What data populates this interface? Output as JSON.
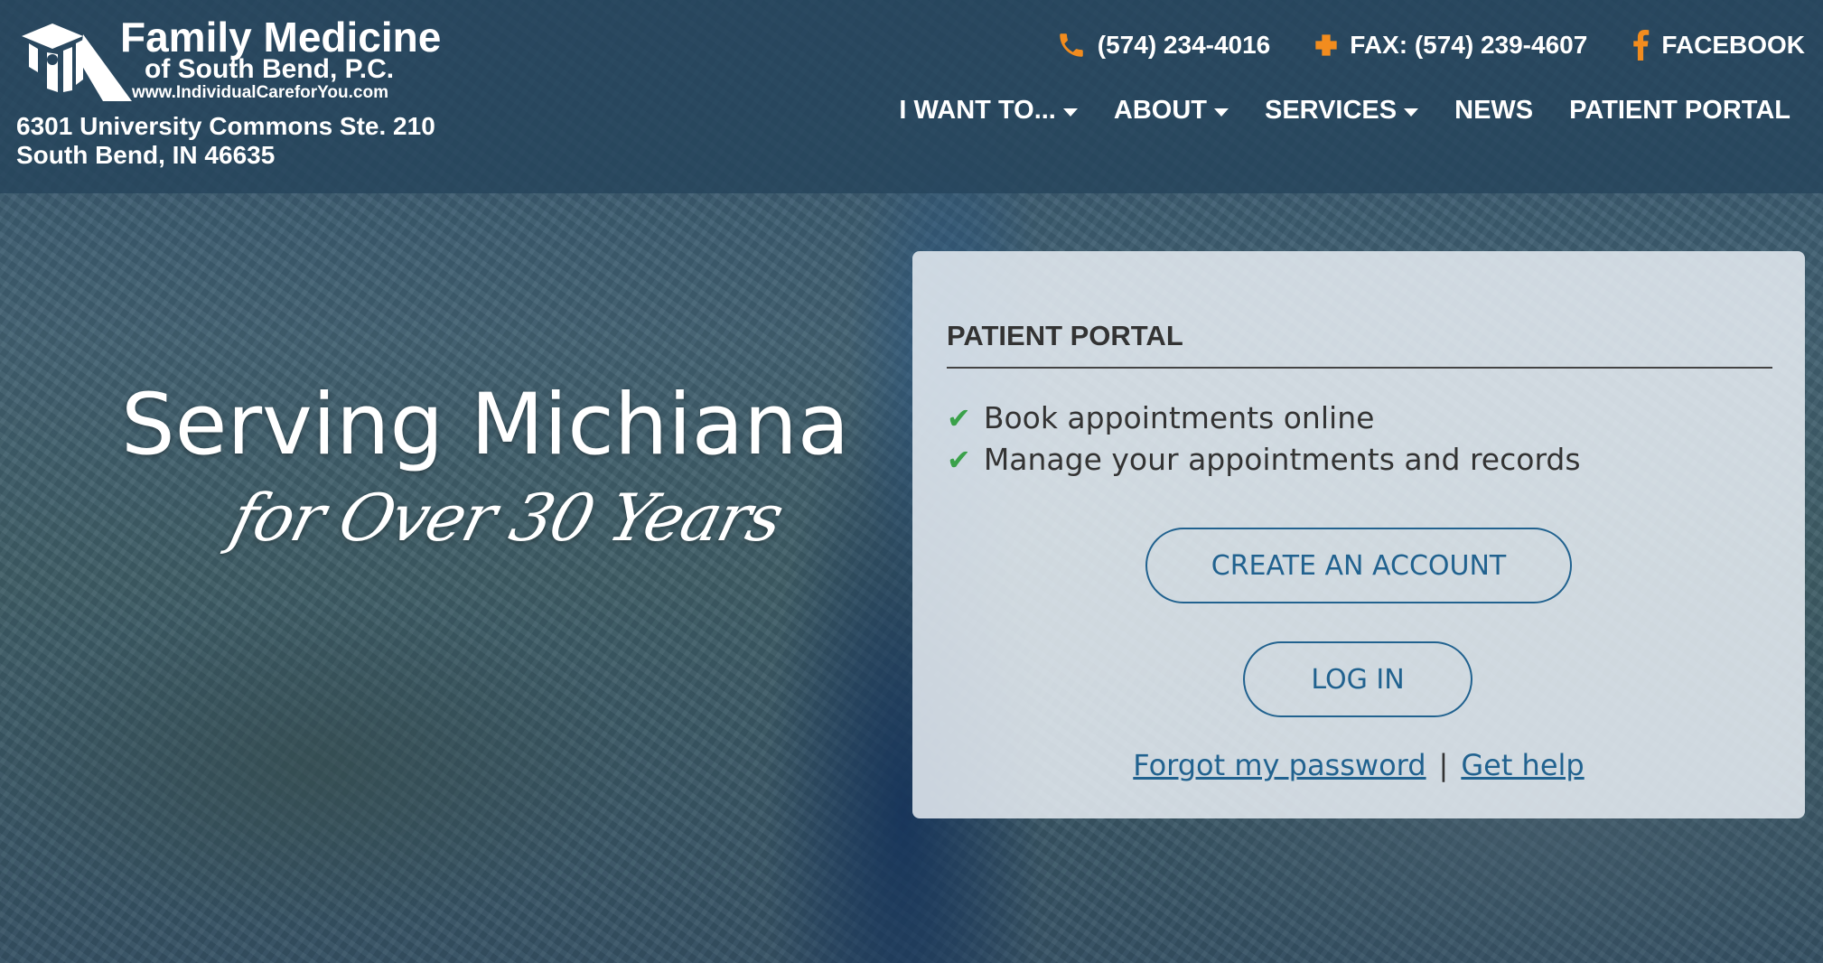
{
  "logo": {
    "title": "Family Medicine",
    "subtitle": "of South Bend, P.C.",
    "url": "www.IndividualCareforYou.com"
  },
  "address": {
    "line1": "6301 University Commons Ste. 210",
    "line2": "South Bend, IN 46635"
  },
  "contact": {
    "phone": "(574) 234-4016",
    "fax": "FAX: (574) 239-4607",
    "facebook": "FACEBOOK"
  },
  "nav": {
    "items": [
      {
        "label": "I WANT TO..."
      },
      {
        "label": "ABOUT"
      },
      {
        "label": "SERVICES"
      },
      {
        "label": "NEWS"
      },
      {
        "label": "PATIENT PORTAL"
      }
    ]
  },
  "hero": {
    "title": "Serving Michiana",
    "script": "for Over 30 Years"
  },
  "portal": {
    "title": "PATIENT PORTAL",
    "features": [
      "Book appointments online",
      "Manage your appointments and records"
    ],
    "create_label": "CREATE AN ACCOUNT",
    "login_label": "LOG IN",
    "forgot_label": "Forgot my password",
    "separator": "|",
    "help_label": "Get help"
  },
  "colors": {
    "accent_orange": "#f28c1e",
    "link_blue": "#21628f",
    "check_green": "#3aa14a",
    "header_bg": "#26445c"
  },
  "icons": [
    "logo-mark-icon",
    "phone-icon",
    "fax-cross-icon",
    "facebook-icon",
    "chevron-down-icon",
    "check-icon"
  ]
}
